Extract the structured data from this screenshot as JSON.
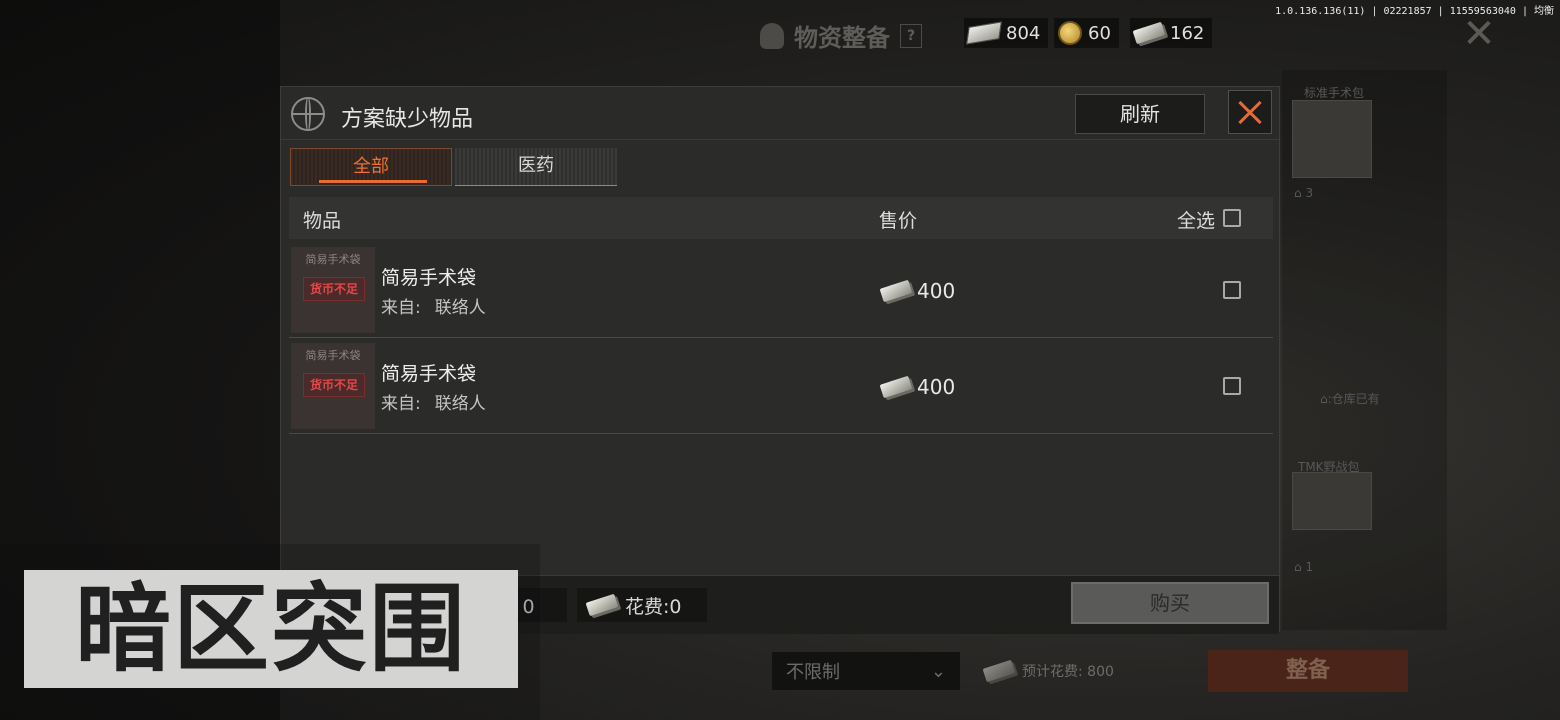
{
  "app": {
    "version_info": "1.0.136.136(11) | 02221857 | 11559563040 | 均衡",
    "page_title": "物资整备",
    "help_label": "?",
    "close_label": "✕",
    "logo_text": "暗区突围"
  },
  "currencies": [
    {
      "icon": "note-icon",
      "value": "804"
    },
    {
      "icon": "coin-icon",
      "value": "60"
    },
    {
      "icon": "cash-icon",
      "value": "162"
    }
  ],
  "background": {
    "side_items": [
      {
        "label": "标准手术包",
        "count": "3"
      },
      {
        "label": "TMK野战包",
        "count": "1"
      }
    ],
    "side_header": "⌂:仓库已有",
    "limit_select": "不限制",
    "estimated_cost": "预计花费: 800",
    "equip_button": "整备"
  },
  "modal": {
    "title": "方案缺少物品",
    "refresh_label": "刷新",
    "tabs": [
      {
        "label": "全部",
        "active": true
      },
      {
        "label": "医药",
        "active": false
      }
    ],
    "table": {
      "col_item": "物品",
      "col_price": "售价",
      "select_all": "全选",
      "rows": [
        {
          "thumb_name": "简易手术袋",
          "status_tag": "货币不足",
          "name": "简易手术袋",
          "source_label": "来自:",
          "source_value": "联络人",
          "price": "400",
          "checked": false
        },
        {
          "thumb_name": "简易手术袋",
          "status_tag": "货币不足",
          "name": "简易手术袋",
          "source_label": "来自:",
          "source_value": "联络人",
          "price": "400",
          "checked": false
        }
      ]
    },
    "footer": {
      "cost_partial": "费: 0",
      "cost_cash": "花费:0",
      "buy_label": "购买"
    }
  },
  "colors": {
    "accent": "#e86a30",
    "warning": "#e44747"
  }
}
